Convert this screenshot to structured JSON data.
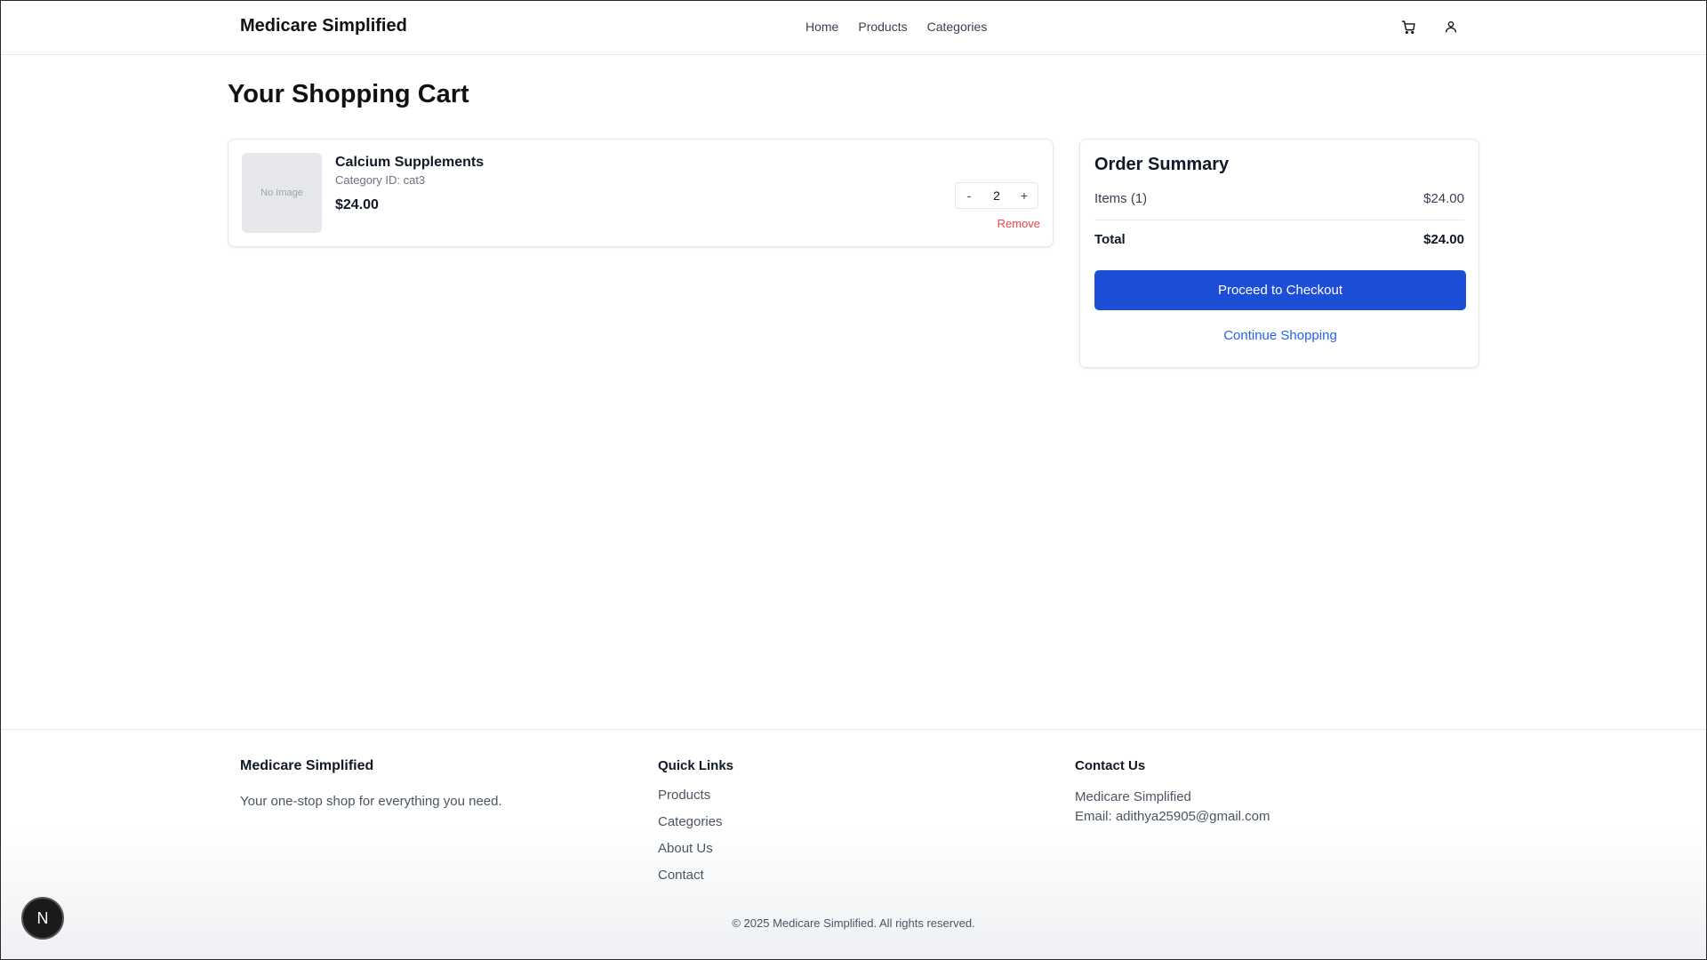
{
  "header": {
    "brand": "Medicare Simplified",
    "nav": [
      "Home",
      "Products",
      "Categories"
    ],
    "cart_icon": "cart-icon",
    "user_icon": "user-icon"
  },
  "main": {
    "title": "Your Shopping Cart",
    "cart_items": [
      {
        "image_placeholder": "No Image",
        "name": "Calcium Supplements",
        "category": "Category ID: cat3",
        "price": "$24.00",
        "quantity": "2",
        "decrement_label": "-",
        "increment_label": "+",
        "remove_label": "Remove"
      }
    ]
  },
  "summary": {
    "title": "Order Summary",
    "items_label": "Items (1)",
    "items_value": "$24.00",
    "total_label": "Total",
    "total_value": "$24.00",
    "checkout_label": "Proceed to Checkout",
    "continue_label": "Continue Shopping",
    "checkout_color": "#1d4ed8",
    "link_color": "#2563eb"
  },
  "footer": {
    "brand": "Medicare Simplified",
    "tagline": "Your one-stop shop for everything you need.",
    "quick_links_title": "Quick Links",
    "quick_links": [
      "Products",
      "Categories",
      "About Us",
      "Contact"
    ],
    "contact_title": "Contact Us",
    "contact_name": "Medicare Simplified",
    "contact_email": "Email: adithya25905@gmail.com",
    "copyright": "© 2025 Medicare Simplified. All rights reserved."
  },
  "dev_badge": {
    "letter": "N",
    "icon": "nextjs-icon"
  }
}
